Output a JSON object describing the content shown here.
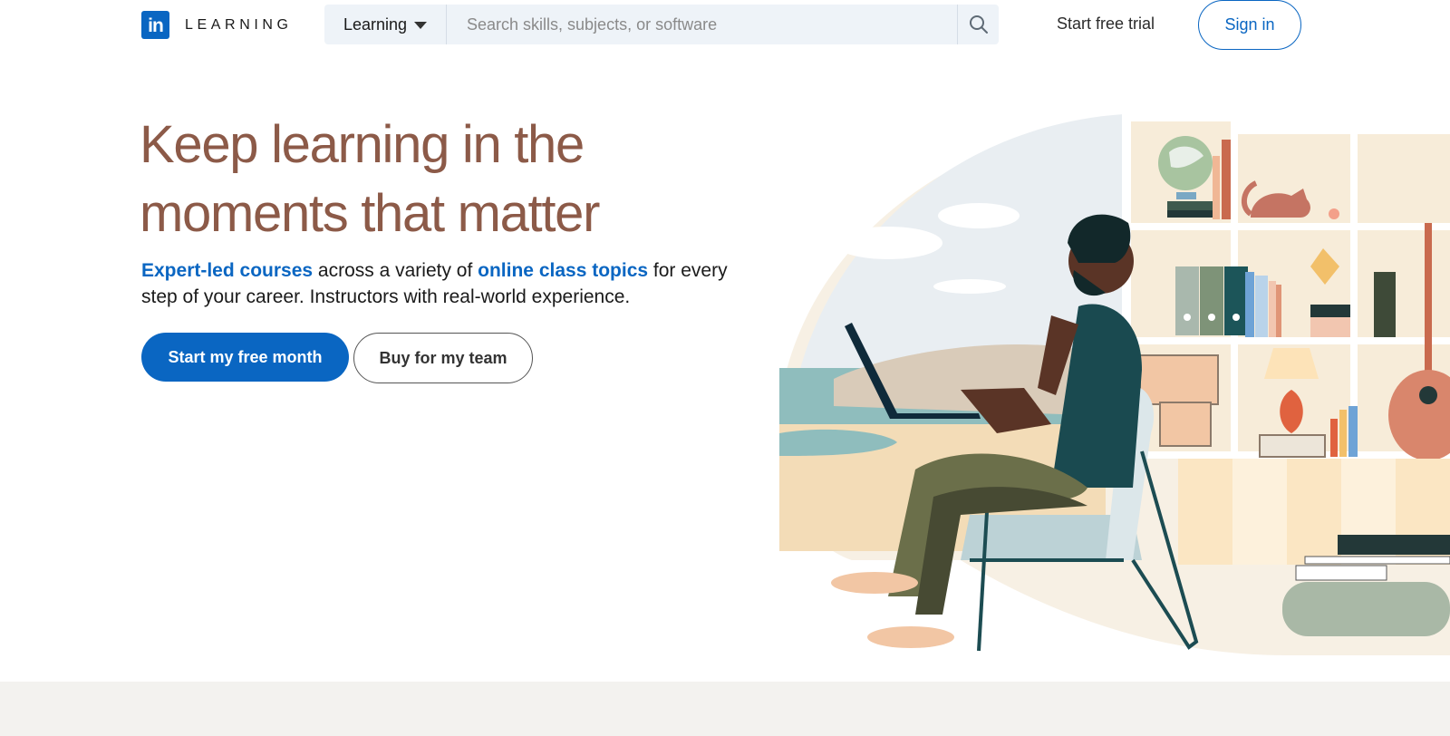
{
  "brand": {
    "logo_mark": "in",
    "product_name": "LEARNING",
    "brand_color": "#0a66c2"
  },
  "search": {
    "category_label": "Learning",
    "placeholder": "Search skills, subjects, or software",
    "value": "",
    "icon": "search-icon"
  },
  "nav": {
    "trial_label": "Start free trial",
    "signin_label": "Sign in"
  },
  "hero": {
    "title_line1": "Keep learning in the",
    "title_line2": "moments that matter",
    "sub_link1": "Expert-led courses",
    "sub_text1": " across a variety of ",
    "sub_link2": "online class topics",
    "sub_text2": " for every step of your career. Instructors with real-world experience.",
    "primary_cta": "Start my free month",
    "secondary_cta": "Buy for my team",
    "title_color": "#8c5a48"
  },
  "illustration": {
    "icon": "person-learning-illustration"
  }
}
